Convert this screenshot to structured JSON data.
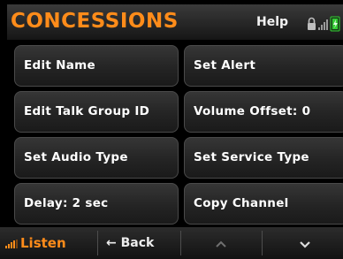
{
  "header": {
    "title": "CONCESSIONS",
    "help_label": "Help",
    "status_icons": [
      "lock-icon",
      "signal-strength-icon",
      "battery-icon"
    ]
  },
  "menu": {
    "items": [
      {
        "label": "Edit Name"
      },
      {
        "label": "Set Alert"
      },
      {
        "label": "Edit Talk Group ID"
      },
      {
        "label": "Volume Offset: 0"
      },
      {
        "label": "Set Audio Type"
      },
      {
        "label": "Set Service Type"
      },
      {
        "label": "Delay: 2 sec"
      },
      {
        "label": "Copy Channel"
      }
    ]
  },
  "bottom_bar": {
    "listen_label": "Listen",
    "back_label": "← Back",
    "up_icon": "chevron-up-icon",
    "down_icon": "chevron-down-icon"
  },
  "colors": {
    "accent": "#ff8c1a",
    "battery": "#33cc33",
    "background": "#000000"
  }
}
